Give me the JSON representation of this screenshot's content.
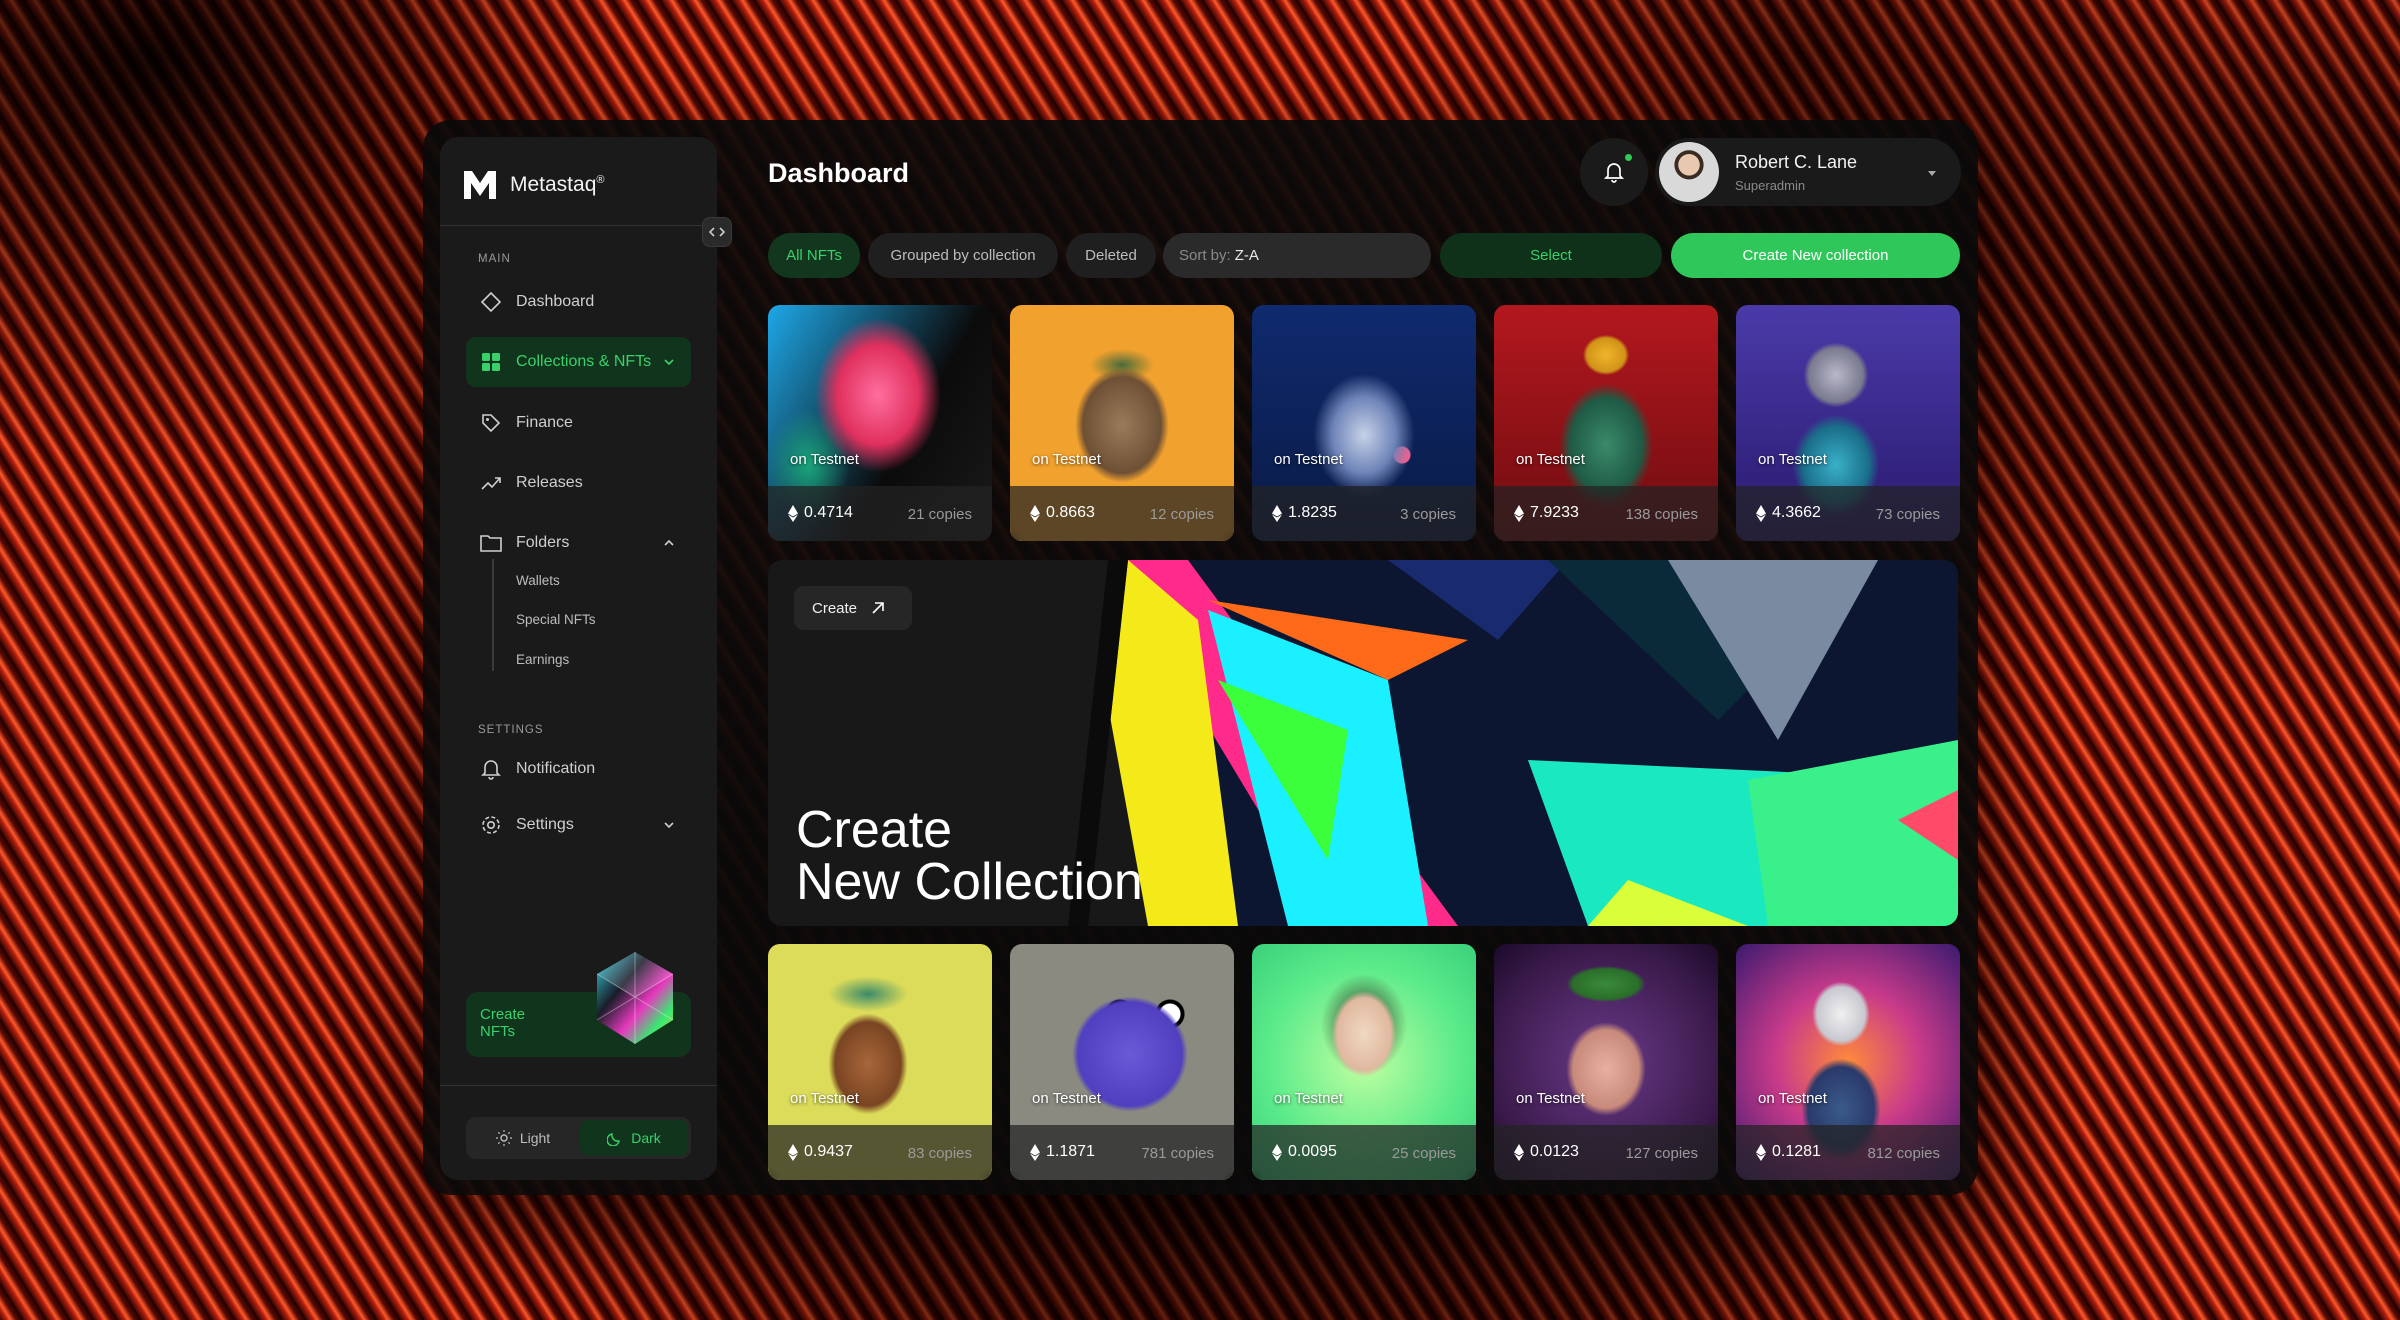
{
  "brand": {
    "name": "Metastaq",
    "mark": "®"
  },
  "sidebar": {
    "section_main": "MAIN",
    "section_settings": "SETTINGS",
    "items": [
      {
        "label": "Dashboard",
        "icon": "diamond-icon"
      },
      {
        "label": "Collections & NFTs",
        "icon": "grid-icon",
        "active": true
      },
      {
        "label": "Finance",
        "icon": "tag-icon"
      },
      {
        "label": "Releases",
        "icon": "trend-icon"
      },
      {
        "label": "Folders",
        "icon": "folder-icon"
      }
    ],
    "folders": [
      "Wallets",
      "Special NFTs",
      "Earnings"
    ],
    "settings_items": [
      {
        "label": "Notification",
        "icon": "bell-icon"
      },
      {
        "label": "Settings",
        "icon": "gear-icon"
      }
    ],
    "cta": "Create NFTs",
    "theme": {
      "light": "Light",
      "dark": "Dark",
      "selected": "Dark"
    }
  },
  "header": {
    "title": "Dashboard",
    "user": {
      "name": "Robert C. Lane",
      "role": "Superadmin"
    }
  },
  "toolbar": {
    "filters": [
      "All NFTs",
      "Grouped by collection",
      "Deleted"
    ],
    "active_filter": "All NFTs",
    "sort_label": "Sort by:",
    "sort_value": "Z-A",
    "select_label": "Select",
    "create_label": "Create New collection"
  },
  "cards_top": [
    {
      "badge": "on Testnet",
      "price": "0.4714",
      "copies": "21 copies"
    },
    {
      "badge": "on Testnet",
      "price": "0.8663",
      "copies": "12 copies"
    },
    {
      "badge": "on Testnet",
      "price": "1.8235",
      "copies": "3 copies"
    },
    {
      "badge": "on Testnet",
      "price": "7.9233",
      "copies": "138 copies"
    },
    {
      "badge": "on Testnet",
      "price": "4.3662",
      "copies": "73 copies"
    }
  ],
  "banner": {
    "button": "Create",
    "title_line1": "Create",
    "title_line2": "New Collection"
  },
  "cards_bottom": [
    {
      "badge": "on Testnet",
      "price": "0.9437",
      "copies": "83 copies"
    },
    {
      "badge": "on Testnet",
      "price": "1.1871",
      "copies": "781 copies"
    },
    {
      "badge": "on Testnet",
      "price": "0.0095",
      "copies": "25 copies"
    },
    {
      "badge": "on Testnet",
      "price": "0.0123",
      "copies": "127 copies"
    },
    {
      "badge": "on Testnet",
      "price": "0.1281",
      "copies": "812 copies"
    }
  ],
  "colors": {
    "accent": "#2fc75a",
    "accent_dark": "#11351c",
    "panel": "#1a1a1a"
  }
}
